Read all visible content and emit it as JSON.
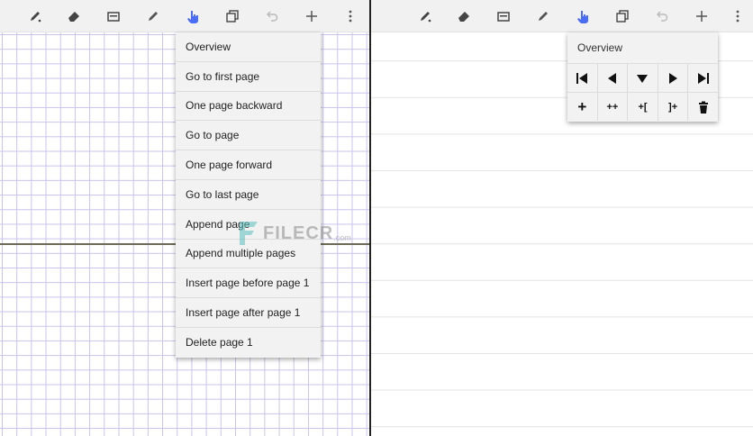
{
  "left_panel": {
    "toolbar_icons": [
      "pen-icon",
      "eraser-icon",
      "text-box-icon",
      "highlighter-icon",
      "hand-pointer-icon",
      "pages-icon",
      "undo-icon",
      "add-icon",
      "more-vertical-icon"
    ],
    "active_tool_color": "#4a6cf7",
    "page_menu": {
      "items": [
        "Overview",
        "Go to first page",
        "One page backward",
        "Go to page",
        "One page forward",
        "Go to last page",
        "Append page",
        "Append multiple pages",
        "Insert page before page 1",
        "Insert page after page 1",
        "Delete page 1"
      ]
    }
  },
  "right_panel": {
    "overview_popup": {
      "title": "Overview",
      "nav_row": [
        "first-page-icon",
        "previous-page-icon",
        "down-arrow-icon",
        "next-page-icon",
        "last-page-icon"
      ],
      "action_row": [
        {
          "icon": "append-page-icon",
          "label": "+"
        },
        {
          "icon": "append-multiple-pages-icon",
          "label": "++"
        },
        {
          "icon": "insert-before-icon",
          "label": "+["
        },
        {
          "icon": "insert-after-icon",
          "label": "]+"
        },
        {
          "icon": "delete-icon",
          "label": ""
        }
      ]
    }
  },
  "watermark": {
    "text": "FILECR",
    "domain": ".com"
  }
}
